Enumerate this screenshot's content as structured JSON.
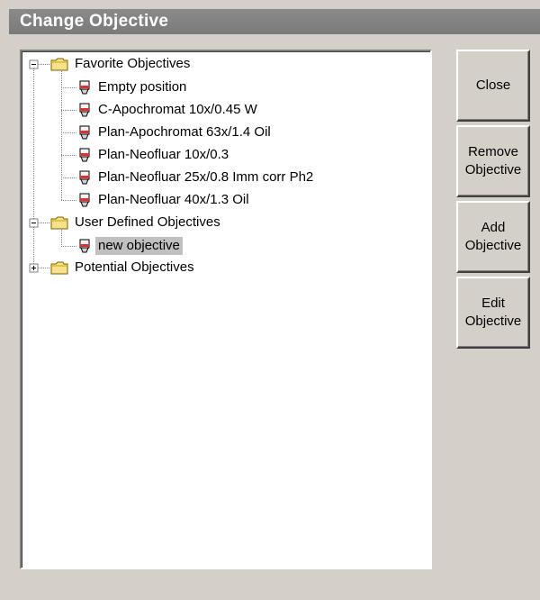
{
  "window": {
    "title": "Change Objective"
  },
  "tree": {
    "groups": [
      {
        "label": "Favorite Objectives",
        "expanded": true,
        "items": [
          "Empty position",
          "C-Apochromat 10x/0.45 W",
          "Plan-Apochromat 63x/1.4 Oil",
          "Plan-Neofluar 10x/0.3",
          "Plan-Neofluar 25x/0.8 Imm corr Ph2",
          "Plan-Neofluar 40x/1.3 Oil"
        ]
      },
      {
        "label": "User Defined Objectives",
        "expanded": true,
        "items": [
          "new objective"
        ],
        "selected_item": "new objective"
      },
      {
        "label": "Potential Objectives",
        "expanded": false,
        "items": []
      }
    ]
  },
  "buttons": {
    "close": "Close",
    "remove": "Remove\nObjective",
    "add": "Add\nObjective",
    "edit": "Edit\nObjective"
  },
  "colors": {
    "titlebar": "#808080",
    "folder": "#f5e28a",
    "selection": "#c0c0c0",
    "objective_accent": "#e03030"
  }
}
